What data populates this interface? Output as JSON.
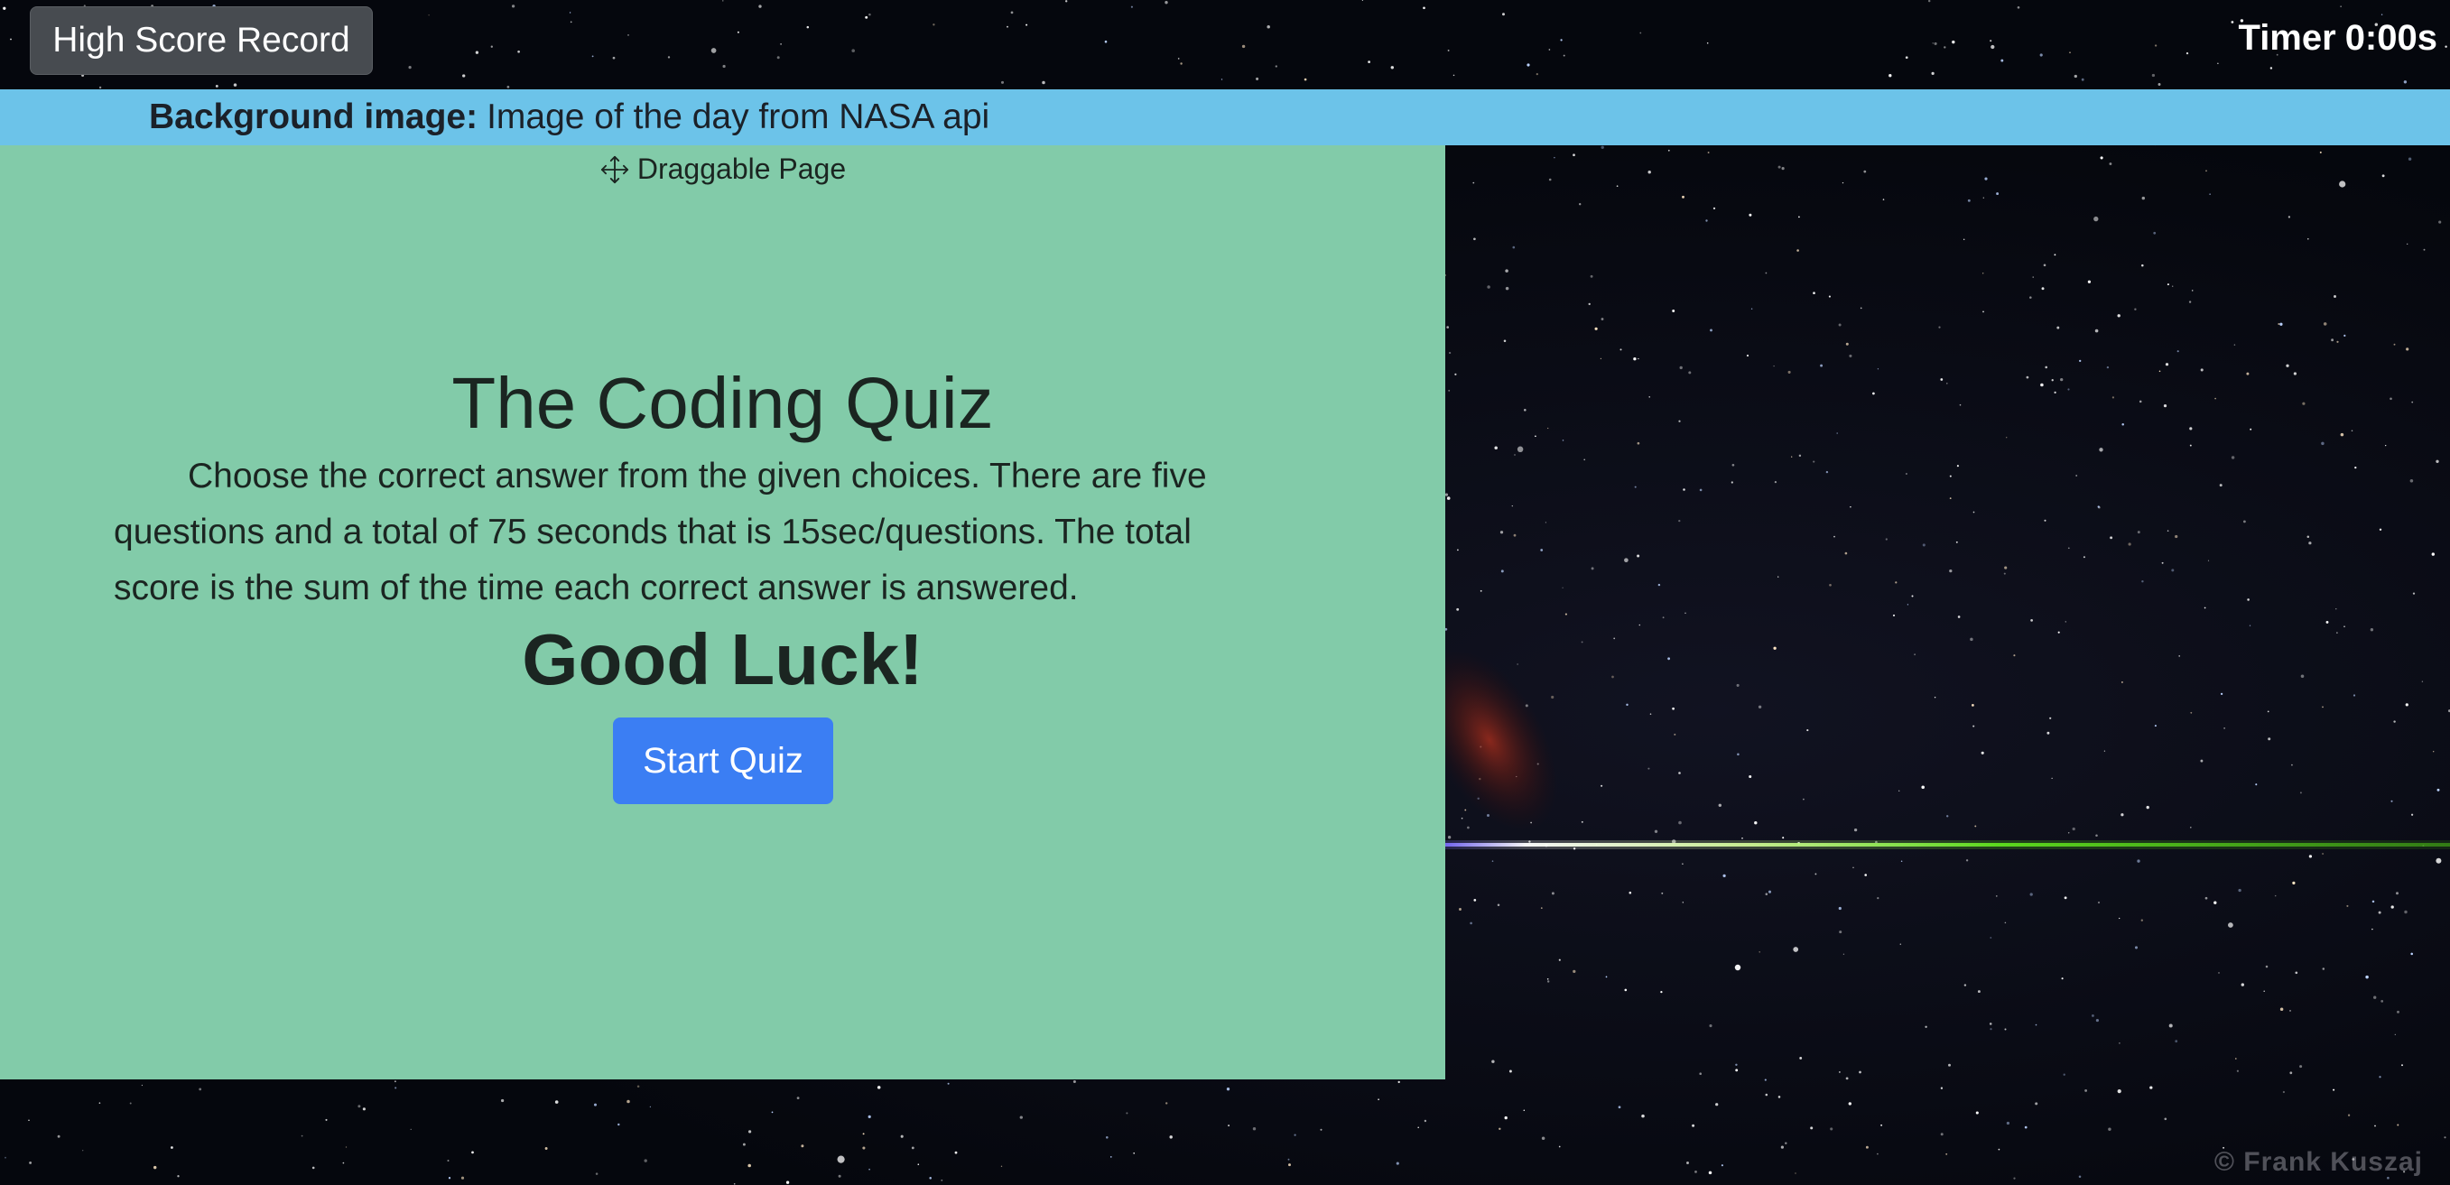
{
  "header": {
    "high_score_label": "High Score Record",
    "timer_label": "Timer",
    "timer_value": "0:00s"
  },
  "banner": {
    "label": "Background image:",
    "text": "Image of the day from NASA api"
  },
  "panel": {
    "drag_label": "Draggable Page",
    "title": "The Coding Quiz",
    "description": "Choose the correct answer from the given choices. There are five questions and a total of 75 seconds that is 15sec/questions. The total score is the sum of the time each correct answer is answered.",
    "good_luck": "Good Luck!",
    "start_label": "Start Quiz"
  },
  "background": {
    "watermark": "© Frank Kuszaj"
  },
  "colors": {
    "banner": "#6cc3e9",
    "panel": "#82cba9",
    "start_button": "#3b7ef3",
    "high_score_button": "#474b50"
  },
  "icons": {
    "drag": "move-arrows-icon"
  }
}
